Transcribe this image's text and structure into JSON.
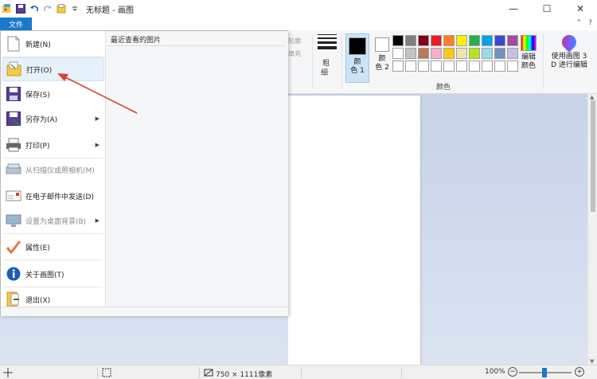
{
  "window": {
    "title": "无标题 - 画图",
    "min_label": "—",
    "max_label": "☐",
    "close_label": "✕"
  },
  "tabs": {
    "file": "文件"
  },
  "ribbon": {
    "outline_label": "轮廓",
    "fill_label": "填充",
    "size_label_a": "粗",
    "size_label_b": "细",
    "color1_a": "颜",
    "color1_b": "色 1",
    "color2_a": "颜",
    "color2_b": "色 2",
    "colors_group": "颜色",
    "edit_colors_a": "编辑",
    "edit_colors_b": "颜色",
    "paint3d_a": "使用画图 3",
    "paint3d_b": "D 进行编辑",
    "color1_value": "#000000",
    "color2_value": "#ffffff",
    "palette": [
      "#000000",
      "#7f7f7f",
      "#880015",
      "#ed1c24",
      "#ff7f27",
      "#fff200",
      "#22b14c",
      "#00a2e8",
      "#3f48cc",
      "#a349a4",
      "#ffffff",
      "#c3c3c3",
      "#b97a57",
      "#ffaec9",
      "#ffc90e",
      "#efe4b0",
      "#b5e61d",
      "#99d9ea",
      "#7092be",
      "#c8bfe7",
      "#ffffff",
      "#ffffff",
      "#ffffff",
      "#ffffff",
      "#ffffff",
      "#ffffff",
      "#ffffff",
      "#ffffff",
      "#ffffff",
      "#ffffff"
    ]
  },
  "file_menu": {
    "recent_title": "最近查看的图片",
    "items": [
      {
        "label": "新建(N)",
        "icon": "new-file-icon",
        "disabled": false,
        "submenu": false
      },
      {
        "label": "打开(O)",
        "icon": "open-folder-icon",
        "disabled": false,
        "submenu": false,
        "highlighted": true
      },
      {
        "label": "保存(S)",
        "icon": "save-icon",
        "disabled": false,
        "submenu": false
      },
      {
        "label": "另存为(A)",
        "icon": "save-as-icon",
        "disabled": false,
        "submenu": true
      },
      {
        "label": "打印(P)",
        "icon": "printer-icon",
        "disabled": false,
        "submenu": true
      },
      {
        "label": "从扫描仪或照相机(M)",
        "icon": "scanner-icon",
        "disabled": true,
        "submenu": false
      },
      {
        "label": "在电子邮件中发送(D)",
        "icon": "email-icon",
        "disabled": false,
        "submenu": false
      },
      {
        "label": "设置为桌面背景(B)",
        "icon": "desktop-background-icon",
        "disabled": true,
        "submenu": true
      },
      {
        "label": "属性(E)",
        "icon": "checkmark-icon",
        "disabled": false,
        "submenu": false
      },
      {
        "label": "关于画图(T)",
        "icon": "info-icon",
        "disabled": false,
        "submenu": false
      },
      {
        "label": "退出(X)",
        "icon": "exit-icon",
        "disabled": false,
        "submenu": false
      }
    ]
  },
  "status": {
    "size": "750 × 1111像素",
    "zoom": "100%",
    "zoom_out": "−",
    "zoom_in": "+"
  }
}
